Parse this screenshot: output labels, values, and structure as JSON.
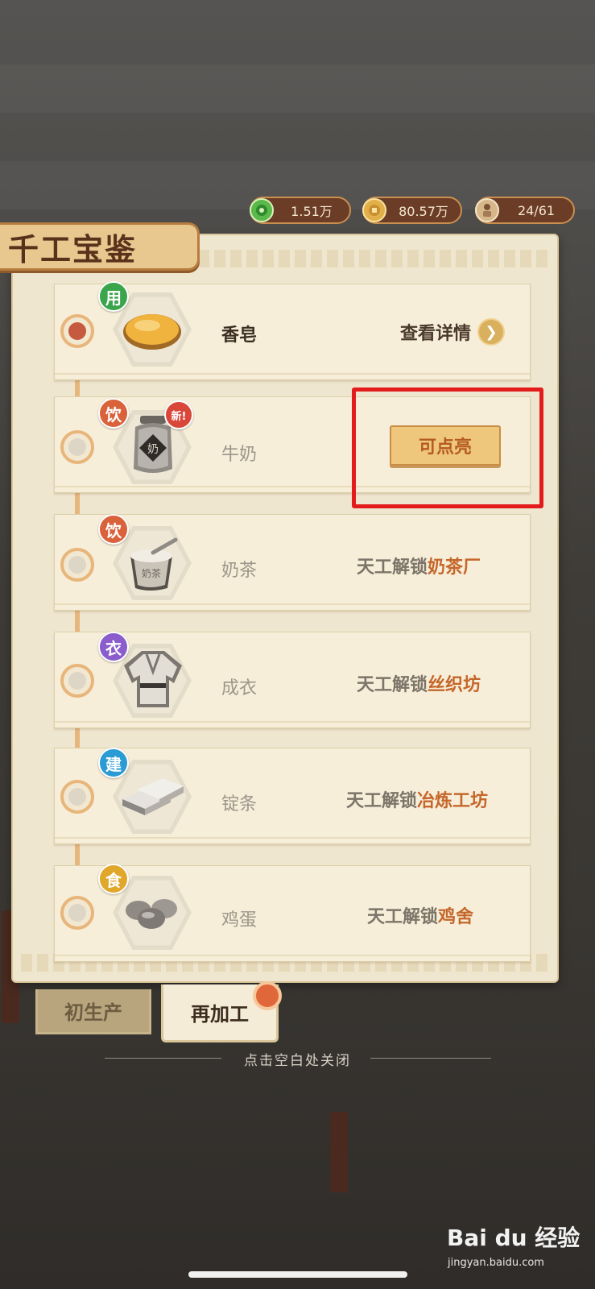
{
  "currencies": [
    {
      "icon": "jade-coin-icon",
      "value": "1.51万"
    },
    {
      "icon": "copper-coin-icon",
      "value": "80.57万"
    },
    {
      "icon": "worker-icon",
      "value": "24/61"
    }
  ],
  "panel": {
    "title": "千工宝鉴"
  },
  "items": [
    {
      "category": "用",
      "name": "香皂",
      "action": "查看详情",
      "icon": "soap-icon",
      "category_color": "#3aa54a"
    },
    {
      "category": "饮",
      "name": "牛奶",
      "badge": "新!",
      "action": "可点亮",
      "icon": "milk-jar-icon",
      "category_color": "#d9623a"
    },
    {
      "category": "饮",
      "name": "奶茶",
      "unlock_prefix": "天工解锁",
      "unlock_target": "奶茶厂",
      "icon": "milk-tea-icon",
      "category_color": "#d9623a"
    },
    {
      "category": "衣",
      "name": "成衣",
      "unlock_prefix": "天工解锁",
      "unlock_target": "丝织坊",
      "icon": "garment-icon",
      "category_color": "#8a5ccc"
    },
    {
      "category": "建",
      "name": "锭条",
      "unlock_prefix": "天工解锁",
      "unlock_target": "冶炼工坊",
      "icon": "ingot-icon",
      "category_color": "#2b9bd4"
    },
    {
      "category": "食",
      "name": "鸡蛋",
      "unlock_prefix": "天工解锁",
      "unlock_target": "鸡舍",
      "icon": "eggs-icon",
      "category_color": "#e0a72a"
    }
  ],
  "tabs": [
    {
      "label": "初生产"
    },
    {
      "label": "再加工"
    }
  ],
  "close_hint": "点击空白处关闭",
  "watermark": {
    "logo": "Bai du 经验",
    "url": "jingyan.baidu.com"
  }
}
